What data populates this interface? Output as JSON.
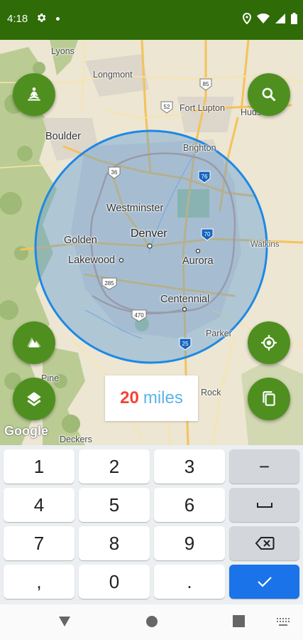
{
  "status_bar": {
    "time": "4:18",
    "icons": [
      "gear-icon",
      "notification-dot-icon",
      "location-pin-icon",
      "wifi-icon",
      "cellular-signal-icon",
      "battery-icon"
    ]
  },
  "map": {
    "provider_logo": "Google",
    "radius_circle_color": "#1e88e5",
    "labels": {
      "lyons": "Lyons",
      "longmont": "Longmont",
      "boulder": "Boulder",
      "fort_lupton": "Fort Lupton",
      "hudson": "Hudso",
      "brighton": "Brighton",
      "westminster": "Westminster",
      "golden": "Golden",
      "denver": "Denver",
      "watkins": "Watkins",
      "lakewood": "Lakewood",
      "aurora": "Aurora",
      "centennial": "Centennial",
      "parker": "Parker",
      "pine": "Pine",
      "rock": "Rock",
      "deckers": "Deckers"
    },
    "shields": {
      "s85": "85",
      "s52": "52",
      "s36": "36",
      "s76": "76",
      "s70": "70",
      "s285": "285",
      "s470": "470",
      "s25": "25"
    }
  },
  "buttons": {
    "top_left": "meditation-person-icon",
    "search": "search-icon",
    "terrain": "terrain-layers-icon",
    "layers": "layers-icon",
    "my_location": "my-location-icon",
    "copy": "copy-icon"
  },
  "radius": {
    "value": "20",
    "unit": "miles"
  },
  "keyboard": {
    "row1": [
      "1",
      "2",
      "3",
      "−"
    ],
    "row2": [
      "4",
      "5",
      "6",
      "space"
    ],
    "row3": [
      "7",
      "8",
      "9",
      "backspace"
    ],
    "row4": [
      ",",
      "0",
      ".",
      "done"
    ]
  },
  "colors": {
    "primary_green": "#4f8f1f",
    "status_bar": "#2f6b07",
    "miles_number": "#f44336",
    "miles_unit": "#5ab4ea",
    "enter_key": "#1a73e8"
  }
}
